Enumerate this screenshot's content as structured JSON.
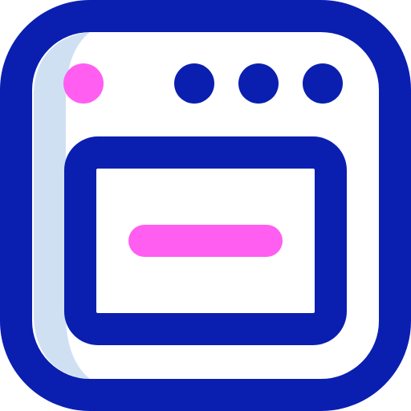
{
  "icon": {
    "name": "oven-icon",
    "colors": {
      "outline": "#0a1fb0",
      "accent": "#ff5ef1",
      "shade": "#cfe0f3",
      "background": "#ffffff"
    }
  }
}
